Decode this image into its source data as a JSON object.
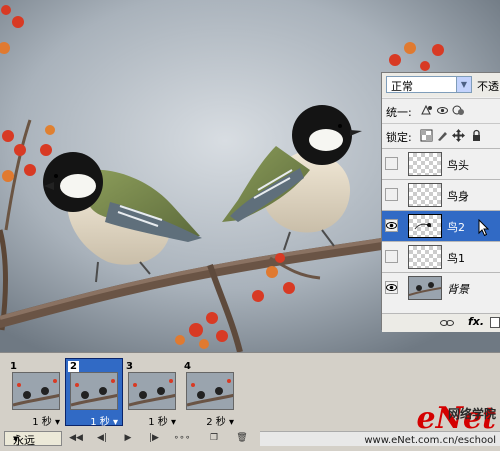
{
  "layers_panel": {
    "blend_mode": "正常",
    "opacity_label": "不透",
    "unify_label": "统一:",
    "lock_label": "锁定:",
    "layers": [
      {
        "name": "鸟头",
        "visible": false,
        "selected": false,
        "italic": false
      },
      {
        "name": "鸟身",
        "visible": false,
        "selected": false,
        "italic": false
      },
      {
        "name": "鸟2",
        "visible": true,
        "selected": true,
        "italic": false
      },
      {
        "name": "鸟1",
        "visible": false,
        "selected": false,
        "italic": false
      },
      {
        "name": "背景",
        "visible": true,
        "selected": false,
        "italic": true
      }
    ],
    "fx_label": "fx."
  },
  "animation_panel": {
    "frames": [
      {
        "number": "1",
        "duration": "1 秒",
        "selected": false
      },
      {
        "number": "2",
        "duration": "1 秒",
        "selected": true
      },
      {
        "number": "3",
        "duration": "1 秒",
        "selected": false
      },
      {
        "number": "4",
        "duration": "2 秒",
        "selected": false
      }
    ],
    "loop_option": "永远"
  },
  "watermark": {
    "logo": "eNet",
    "cn": "网络学院",
    "url": "www.eNet.com.cn/eschool"
  },
  "colors": {
    "selection": "#316ac5",
    "watermark_red": "#d40000"
  }
}
